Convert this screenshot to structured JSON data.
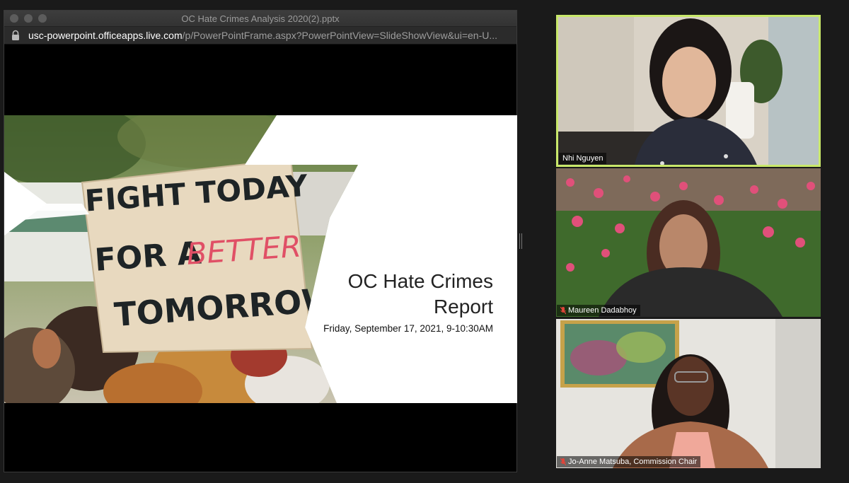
{
  "window": {
    "title": "OC Hate Crimes Analysis 2020(2).pptx",
    "url_host": "usc-powerpoint.officeapps.live.com",
    "url_path": "/p/PowerPointFrame.aspx?PowerPointView=SlideShowView&ui=en-U..."
  },
  "slide": {
    "title_line1": "OC Hate Crimes",
    "title_line2": "Report",
    "subtitle": "Friday, September 17, 2021,  9-10:30AM",
    "sign_line1": "FIGHT TODAY",
    "sign_line2a": "FOR A",
    "sign_line2b": "BETTER",
    "sign_line3": "TOMORROW"
  },
  "participants": [
    {
      "name": "Nhi Nguyen",
      "muted": false,
      "active": true
    },
    {
      "name": "Maureen Dadabhoy",
      "muted": true,
      "active": false
    },
    {
      "name": "Jo-Anne Matsuba, Commission Chair",
      "muted": true,
      "active": false
    }
  ],
  "colors": {
    "active_speaker_border": "#c8e86a",
    "mic_muted": "#e0453a",
    "background": "#1a1a1a"
  }
}
